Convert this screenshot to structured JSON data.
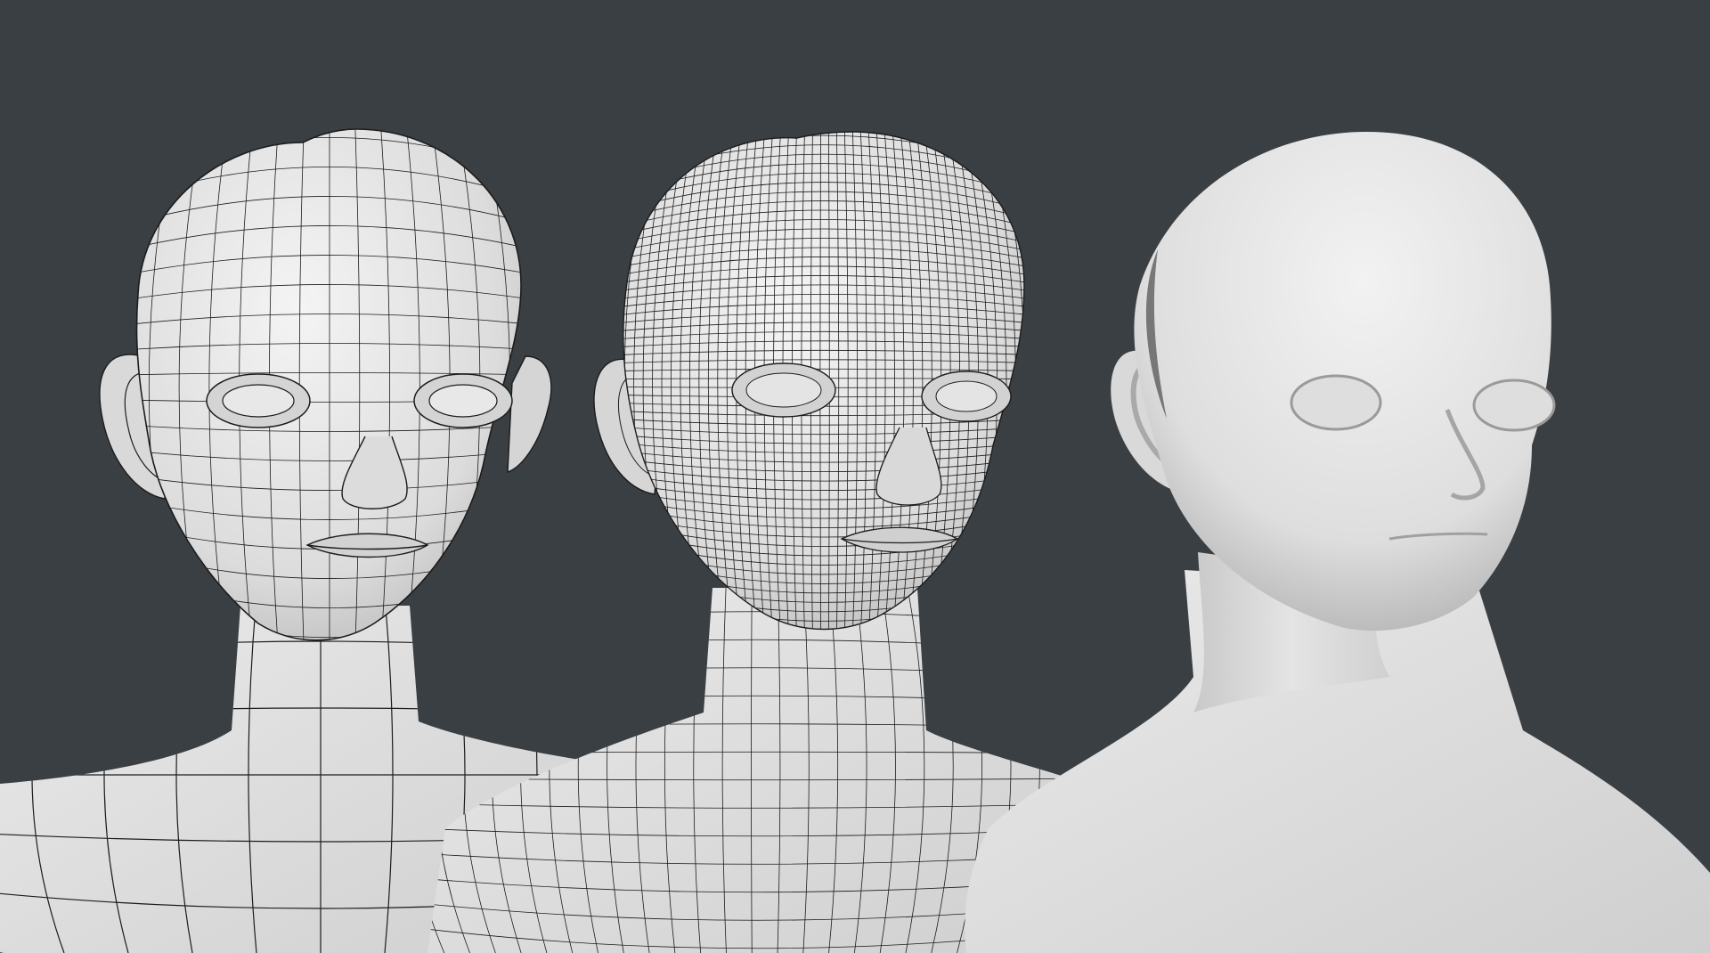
{
  "scene": {
    "background_color": "#3a3f43",
    "mesh_surface_color": "#e6e6e6",
    "wire_color": "#1c1c1c",
    "smooth_surface_color": "#e8e8e8",
    "models": [
      {
        "name": "low-poly-wireframe-bust",
        "wire_density": 10
      },
      {
        "name": "subdivided-wireframe-bust",
        "wire_density": 24
      },
      {
        "name": "smooth-shaded-bust",
        "wire_density": 0
      }
    ]
  }
}
